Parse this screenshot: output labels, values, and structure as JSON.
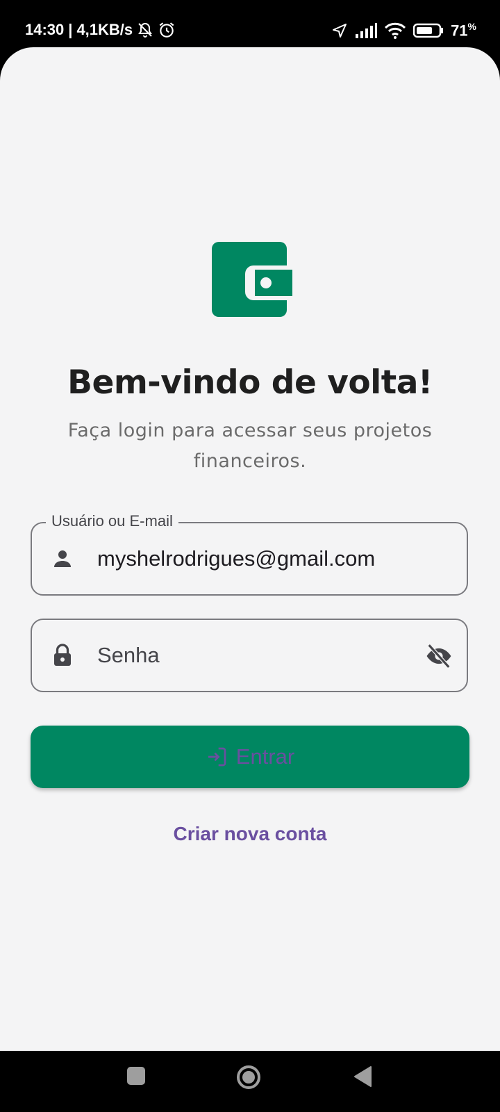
{
  "status_bar": {
    "time": "14:30",
    "separator": "|",
    "network_speed": "4,1KB/s",
    "battery_percent": "71",
    "battery_unit": "%",
    "icons": [
      "notifications-off-icon",
      "alarm-icon",
      "location-arrow-icon",
      "signal-icon",
      "wifi-icon",
      "battery-icon"
    ]
  },
  "app": {
    "logo_icon": "wallet-icon",
    "title": "Bem-vindo de volta!",
    "subtitle": "Faça login para acessar seus projetos financeiros.",
    "email_field": {
      "label": "Usuário ou E-mail",
      "value": "myshelrodrigues@gmail.com",
      "icon": "person-icon"
    },
    "password_field": {
      "placeholder": "Senha",
      "icon": "lock-icon",
      "toggle_icon": "visibility-off-icon"
    },
    "login_button": {
      "label": "Entrar",
      "icon": "login-icon"
    },
    "create_account_link": "Criar nova conta"
  },
  "nav_bar": {
    "icons": [
      "recents-square-icon",
      "home-circle-icon",
      "back-triangle-icon"
    ]
  },
  "colors": {
    "primary": "#008761",
    "link": "#6a4fa0",
    "background": "#f4f4f5",
    "title": "#1f1f1f",
    "subtitle": "#6b6b6b"
  }
}
